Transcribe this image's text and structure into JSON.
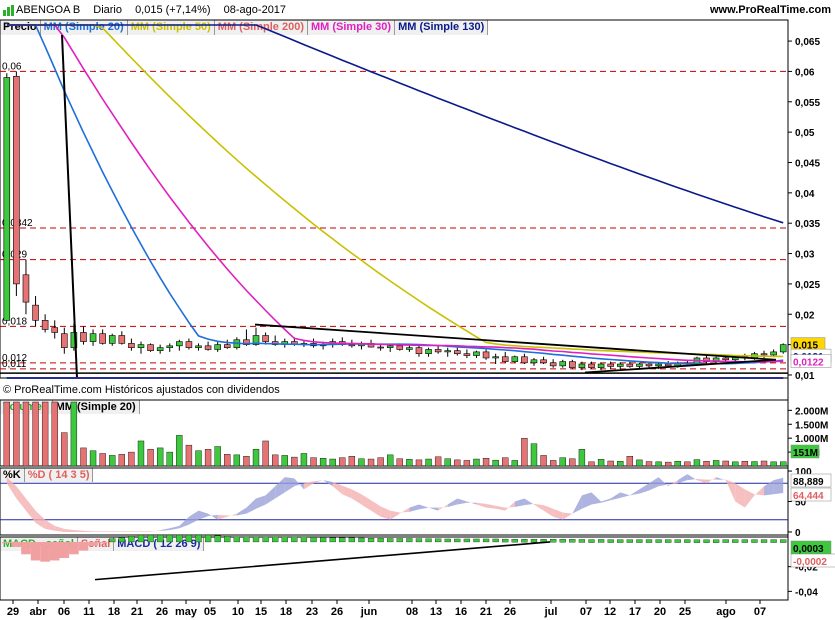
{
  "header": {
    "ticker": "ABENGOA B",
    "period": "Diario",
    "quote": "0,015 (+7,14%)",
    "date": "08-ago-2017",
    "site": "www.ProRealTime.com"
  },
  "price_panel": {
    "labels": [
      {
        "text": "Precio",
        "color": "#000000"
      },
      {
        "text": "MM (Simple 20)",
        "color": "#1e6fd9"
      },
      {
        "text": "MM (Simple 50)",
        "color": "#c8c000"
      },
      {
        "text": "MM (Simple 200)",
        "color": "#e06060"
      },
      {
        "text": "MM (Simple 30)",
        "color": "#e020c0"
      },
      {
        "text": "MM (Simple 130)",
        "color": "#0a1a8a"
      }
    ],
    "attribution": "© ProRealTime.com  Históricos ajustados con dividendos"
  },
  "volume_panel": {
    "labels": [
      {
        "text": "Volumen",
        "color": "#2ab02a"
      },
      {
        "text": "MM (Simple 20)",
        "color": "#000000"
      }
    ]
  },
  "stoch_panel": {
    "labels": [
      {
        "text": "%K",
        "color": "#000000"
      },
      {
        "text": "%D ( 14 3 5)",
        "color": "#e06060"
      }
    ]
  },
  "macd_panel": {
    "labels": [
      {
        "text": "MACD - señal",
        "color": "#2ab02a"
      },
      {
        "text": "Señal",
        "color": "#e06060"
      },
      {
        "text": "MACD ( 12 26 9)",
        "color": "#1a2aa0"
      }
    ]
  },
  "colors": {
    "up": "#3ec83e",
    "down": "#e57373",
    "sma20": "#1e6fd9",
    "sma50": "#c8c000",
    "sma30": "#e020c0",
    "sma130": "#0a1a8a",
    "trend": "#000000",
    "hline": "#c00000"
  },
  "chart_data": [
    {
      "type": "candlestick",
      "name": "price",
      "x_ticks": [
        "29",
        "abr",
        "06",
        "11",
        "18",
        "21",
        "26",
        "may",
        "05",
        "10",
        "15",
        "18",
        "23",
        "26",
        "jun",
        "08",
        "13",
        "16",
        "21",
        "26",
        "jul",
        "07",
        "12",
        "17",
        "20",
        "25",
        "ago",
        "07"
      ],
      "ylim": [
        0.0095,
        0.066
      ],
      "y_ticks": [
        "0,065",
        "0,06",
        "0,055",
        "0,05",
        "0,045",
        "0,04",
        "0,035",
        "0,03",
        "0,025",
        "0,02",
        "0,015",
        "0,01"
      ],
      "hlines": [
        0.06,
        0.0342,
        0.029,
        0.018,
        0.012,
        0.011
      ],
      "hline_labels": [
        "0,06",
        "0,0342",
        "0,029",
        "0,018",
        "0,012",
        "0,011"
      ],
      "last_labels": [
        {
          "text": "0,015",
          "value": 0.015,
          "bg": "#ffd700",
          "fg": "#000000"
        },
        {
          "text": "0,0131",
          "value": 0.0131,
          "bg": "#ffffff",
          "fg": "#0a1a8a"
        },
        {
          "text": "0,0122",
          "value": 0.0122,
          "bg": "#ffffff",
          "fg": "#e020c0"
        }
      ],
      "candles": [
        [
          0.019,
          0.0597,
          0.019,
          0.059
        ],
        [
          0.0592,
          0.06,
          0.023,
          0.025
        ],
        [
          0.0265,
          0.029,
          0.02,
          0.022
        ],
        [
          0.0215,
          0.023,
          0.018,
          0.019
        ],
        [
          0.019,
          0.02,
          0.017,
          0.0175
        ],
        [
          0.0178,
          0.019,
          0.016,
          0.017
        ],
        [
          0.0168,
          0.0178,
          0.0135,
          0.0145
        ],
        [
          0.0145,
          0.0185,
          0.014,
          0.017
        ],
        [
          0.017,
          0.018,
          0.015,
          0.0155
        ],
        [
          0.0155,
          0.0175,
          0.0148,
          0.0168
        ],
        [
          0.0168,
          0.0175,
          0.015,
          0.0152
        ],
        [
          0.0152,
          0.0168,
          0.0148,
          0.0165
        ],
        [
          0.0165,
          0.0172,
          0.015,
          0.0152
        ],
        [
          0.0152,
          0.016,
          0.014,
          0.0145
        ],
        [
          0.0145,
          0.0155,
          0.0135,
          0.015
        ],
        [
          0.015,
          0.0152,
          0.0138,
          0.014
        ],
        [
          0.014,
          0.015,
          0.0135,
          0.0145
        ],
        [
          0.0145,
          0.0152,
          0.0138,
          0.0148
        ],
        [
          0.0148,
          0.0158,
          0.014,
          0.0155
        ],
        [
          0.0155,
          0.016,
          0.0142,
          0.0145
        ],
        [
          0.0145,
          0.0152,
          0.014,
          0.0148
        ],
        [
          0.0148,
          0.0155,
          0.014,
          0.0142
        ],
        [
          0.0142,
          0.0155,
          0.0138,
          0.015
        ],
        [
          0.015,
          0.0158,
          0.0143,
          0.0145
        ],
        [
          0.0145,
          0.0162,
          0.0142,
          0.0158
        ],
        [
          0.0158,
          0.0175,
          0.0148,
          0.015
        ],
        [
          0.015,
          0.0178,
          0.0148,
          0.0165
        ],
        [
          0.0165,
          0.017,
          0.015,
          0.0155
        ],
        [
          0.0155,
          0.0165,
          0.0148,
          0.015
        ],
        [
          0.015,
          0.016,
          0.0145,
          0.0155
        ],
        [
          0.0155,
          0.0162,
          0.0148,
          0.015
        ],
        [
          0.015,
          0.0158,
          0.0146,
          0.0152
        ],
        [
          0.0152,
          0.016,
          0.0145,
          0.0148
        ],
        [
          0.0148,
          0.0155,
          0.0142,
          0.015
        ],
        [
          0.015,
          0.016,
          0.0145,
          0.0155
        ],
        [
          0.0155,
          0.0162,
          0.0148,
          0.015
        ],
        [
          0.015,
          0.0158,
          0.0145,
          0.0148
        ],
        [
          0.0148,
          0.0155,
          0.0142,
          0.0152
        ],
        [
          0.0152,
          0.0158,
          0.0145,
          0.0146
        ],
        [
          0.0146,
          0.0152,
          0.014,
          0.0145
        ],
        [
          0.0145,
          0.015,
          0.0138,
          0.0148
        ],
        [
          0.0148,
          0.0152,
          0.014,
          0.0142
        ],
        [
          0.0142,
          0.015,
          0.0138,
          0.0145
        ],
        [
          0.0145,
          0.015,
          0.013,
          0.0135
        ],
        [
          0.0135,
          0.0145,
          0.013,
          0.0142
        ],
        [
          0.0142,
          0.0148,
          0.0135,
          0.0138
        ],
        [
          0.0138,
          0.0145,
          0.013,
          0.014
        ],
        [
          0.014,
          0.0145,
          0.0132,
          0.0135
        ],
        [
          0.0135,
          0.0142,
          0.0128,
          0.0132
        ],
        [
          0.0132,
          0.014,
          0.0128,
          0.0138
        ],
        [
          0.0138,
          0.0142,
          0.0125,
          0.0128
        ],
        [
          0.0128,
          0.0135,
          0.0118,
          0.013
        ],
        [
          0.013,
          0.0138,
          0.012,
          0.0122
        ],
        [
          0.0122,
          0.0132,
          0.012,
          0.013
        ],
        [
          0.013,
          0.0135,
          0.0118,
          0.012
        ],
        [
          0.012,
          0.0128,
          0.0115,
          0.0125
        ],
        [
          0.0125,
          0.013,
          0.0118,
          0.012
        ],
        [
          0.012,
          0.0126,
          0.0112,
          0.0115
        ],
        [
          0.0115,
          0.0125,
          0.0112,
          0.0122
        ],
        [
          0.0122,
          0.0125,
          0.011,
          0.0112
        ],
        [
          0.0112,
          0.0122,
          0.0108,
          0.0118
        ],
        [
          0.0118,
          0.0122,
          0.011,
          0.0112
        ],
        [
          0.0112,
          0.012,
          0.0108,
          0.0118
        ],
        [
          0.0118,
          0.0122,
          0.011,
          0.0114
        ],
        [
          0.0114,
          0.0121,
          0.011,
          0.0118
        ],
        [
          0.0118,
          0.0122,
          0.0112,
          0.0114
        ],
        [
          0.0114,
          0.012,
          0.011,
          0.0118
        ],
        [
          0.0118,
          0.0122,
          0.0112,
          0.0115
        ],
        [
          0.0115,
          0.012,
          0.011,
          0.0118
        ],
        [
          0.0118,
          0.0123,
          0.0113,
          0.0115
        ],
        [
          0.0115,
          0.0122,
          0.0112,
          0.012
        ],
        [
          0.012,
          0.0125,
          0.0114,
          0.0118
        ],
        [
          0.0118,
          0.013,
          0.0115,
          0.0128
        ],
        [
          0.0128,
          0.0132,
          0.0118,
          0.0122
        ],
        [
          0.0122,
          0.013,
          0.0118,
          0.0128
        ],
        [
          0.0128,
          0.0133,
          0.0122,
          0.0125
        ],
        [
          0.0125,
          0.0132,
          0.012,
          0.013
        ],
        [
          0.013,
          0.0135,
          0.0124,
          0.0128
        ],
        [
          0.0128,
          0.0138,
          0.0125,
          0.0135
        ],
        [
          0.0135,
          0.014,
          0.0128,
          0.0133
        ],
        [
          0.0133,
          0.0142,
          0.013,
          0.0138
        ],
        [
          0.0138,
          0.0152,
          0.0135,
          0.015
        ]
      ]
    },
    {
      "type": "bar",
      "name": "volume",
      "y_ticks": [
        "2.000M",
        "1.500M",
        "1.000M",
        "500M"
      ],
      "y_tick_values": [
        2000,
        1500,
        1000,
        500
      ],
      "ylim": [
        0,
        2300
      ],
      "last_label": {
        "text": "151M",
        "bg": "#3ec83e",
        "fg": "#000000"
      },
      "values": [
        2300,
        2300,
        2300,
        2300,
        2300,
        2300,
        1200,
        2300,
        650,
        550,
        450,
        380,
        420,
        500,
        900,
        600,
        650,
        500,
        1100,
        750,
        550,
        600,
        700,
        420,
        400,
        350,
        600,
        900,
        400,
        380,
        320,
        450,
        300,
        280,
        250,
        300,
        350,
        260,
        250,
        300,
        400,
        260,
        240,
        220,
        250,
        330,
        260,
        220,
        200,
        250,
        280,
        210,
        300,
        200,
        1000,
        800,
        380,
        200,
        300,
        260,
        600,
        150,
        240,
        180,
        170,
        350,
        220,
        160,
        150,
        140,
        170,
        150,
        230,
        170,
        200,
        180,
        150,
        170,
        160,
        180,
        150,
        151
      ]
    },
    {
      "type": "line",
      "name": "stochastic",
      "y_ticks": [
        "100",
        "50",
        "0"
      ],
      "ylim": [
        -5,
        105
      ],
      "hlines": [
        80,
        20
      ],
      "last_labels": [
        {
          "text": "88,889",
          "bg": "#ffffff",
          "fg": "#000000"
        },
        {
          "text": "64,444",
          "bg": "#ffffff",
          "fg": "#e06060"
        }
      ],
      "series": [
        {
          "name": "%K",
          "values": [
            80,
            55,
            35,
            15,
            5,
            2,
            0,
            0,
            0,
            0,
            0,
            0,
            0,
            0,
            0,
            0,
            3,
            6,
            10,
            25,
            35,
            30,
            20,
            25,
            30,
            40,
            55,
            60,
            75,
            90,
            88,
            70,
            80,
            85,
            75,
            62,
            55,
            45,
            35,
            25,
            20,
            30,
            40,
            45,
            40,
            35,
            45,
            55,
            50,
            45,
            40,
            38,
            35,
            50,
            55,
            45,
            35,
            25,
            20,
            30,
            60,
            65,
            50,
            55,
            65,
            60,
            70,
            80,
            90,
            75,
            85,
            95,
            85,
            80,
            90,
            85,
            50,
            40,
            60,
            75,
            85,
            89
          ]
        },
        {
          "name": "%D ( 14 3 5)",
          "values": [
            90,
            75,
            55,
            35,
            20,
            10,
            5,
            3,
            2,
            1,
            1,
            1,
            1,
            1,
            1,
            1,
            2,
            3,
            6,
            12,
            20,
            26,
            28,
            27,
            27,
            30,
            38,
            45,
            55,
            65,
            75,
            80,
            83,
            85,
            82,
            76,
            70,
            62,
            52,
            42,
            35,
            32,
            33,
            37,
            40,
            40,
            41,
            45,
            48,
            48,
            46,
            43,
            40,
            41,
            44,
            46,
            44,
            38,
            32,
            30,
            38,
            45,
            48,
            52,
            56,
            60,
            63,
            68,
            75,
            78,
            80,
            85,
            87,
            86,
            86,
            86,
            80,
            70,
            62,
            60,
            62,
            64
          ]
        }
      ]
    },
    {
      "type": "line",
      "name": "macd",
      "y_ticks": [
        "-0,02",
        "-0,04"
      ],
      "y_tick_values": [
        -0.02,
        -0.04
      ],
      "ylim": [
        -0.047,
        0.004
      ],
      "last_labels": [
        {
          "text": "0,0003",
          "bg": "#3ec83e",
          "fg": "#000000"
        },
        {
          "text": "-0,0002",
          "bg": "#ffffff",
          "fg": "#e06060"
        }
      ],
      "series": [
        {
          "name": "MACD ( 12 26 9)",
          "values": [
            -0.001,
            -0.006,
            -0.014,
            -0.022,
            -0.027,
            -0.03,
            -0.031,
            -0.031,
            -0.03,
            -0.028,
            -0.026,
            -0.024,
            -0.022,
            -0.02,
            -0.018,
            -0.017,
            -0.016,
            -0.015,
            -0.014,
            -0.013,
            -0.012,
            -0.011,
            -0.0105,
            -0.01,
            -0.0095,
            -0.009,
            -0.0085,
            -0.008,
            -0.0075,
            -0.007,
            -0.0065,
            -0.006,
            -0.0057,
            -0.0054,
            -0.0051,
            -0.0048,
            -0.0045,
            -0.0042,
            -0.004,
            -0.0037,
            -0.0034,
            -0.0031,
            -0.0028,
            -0.0026,
            -0.0024,
            -0.0022,
            -0.002,
            -0.0018,
            -0.0016,
            -0.0014,
            -0.0012,
            -0.001,
            -0.0009,
            -0.0008,
            -0.0007,
            -0.0006,
            -0.0005,
            -0.0004,
            -0.0004,
            -0.0003,
            -0.0003,
            -0.0003,
            -0.0002,
            -0.0002,
            -0.0002,
            -0.0001,
            -0.0001,
            -0.0001,
            0.0,
            0.0,
            0.0,
            0.0,
            0.0,
            0.0,
            0.0,
            0.0001,
            0.0001,
            0.0001,
            0.0001,
            0.0001,
            0.0001,
            0.0001
          ]
        },
        {
          "name": "Señal",
          "values": [
            0.0,
            -0.002,
            -0.004,
            -0.007,
            -0.011,
            -0.015,
            -0.018,
            -0.021,
            -0.023,
            -0.025,
            -0.025,
            -0.025,
            -0.024,
            -0.023,
            -0.022,
            -0.021,
            -0.02,
            -0.019,
            -0.018,
            -0.017,
            -0.016,
            -0.015,
            -0.014,
            -0.013,
            -0.012,
            -0.0115,
            -0.011,
            -0.0105,
            -0.01,
            -0.0095,
            -0.009,
            -0.0085,
            -0.008,
            -0.0075,
            -0.007,
            -0.0066,
            -0.0062,
            -0.0058,
            -0.0054,
            -0.005,
            -0.0046,
            -0.0043,
            -0.004,
            -0.0037,
            -0.0034,
            -0.0031,
            -0.0028,
            -0.0026,
            -0.0024,
            -0.0022,
            -0.002,
            -0.0018,
            -0.0016,
            -0.0014,
            -0.0013,
            -0.0012,
            -0.0011,
            -0.001,
            -0.0009,
            -0.0008,
            -0.0007,
            -0.0006,
            -0.0006,
            -0.0005,
            -0.0005,
            -0.0004,
            -0.0004,
            -0.0004,
            -0.0003,
            -0.0003,
            -0.0003,
            -0.0003,
            -0.0002,
            -0.0002,
            -0.0002,
            -0.0002,
            -0.0002,
            -0.0002,
            -0.0002,
            -0.0002,
            -0.0002,
            -0.0002
          ]
        }
      ]
    }
  ]
}
